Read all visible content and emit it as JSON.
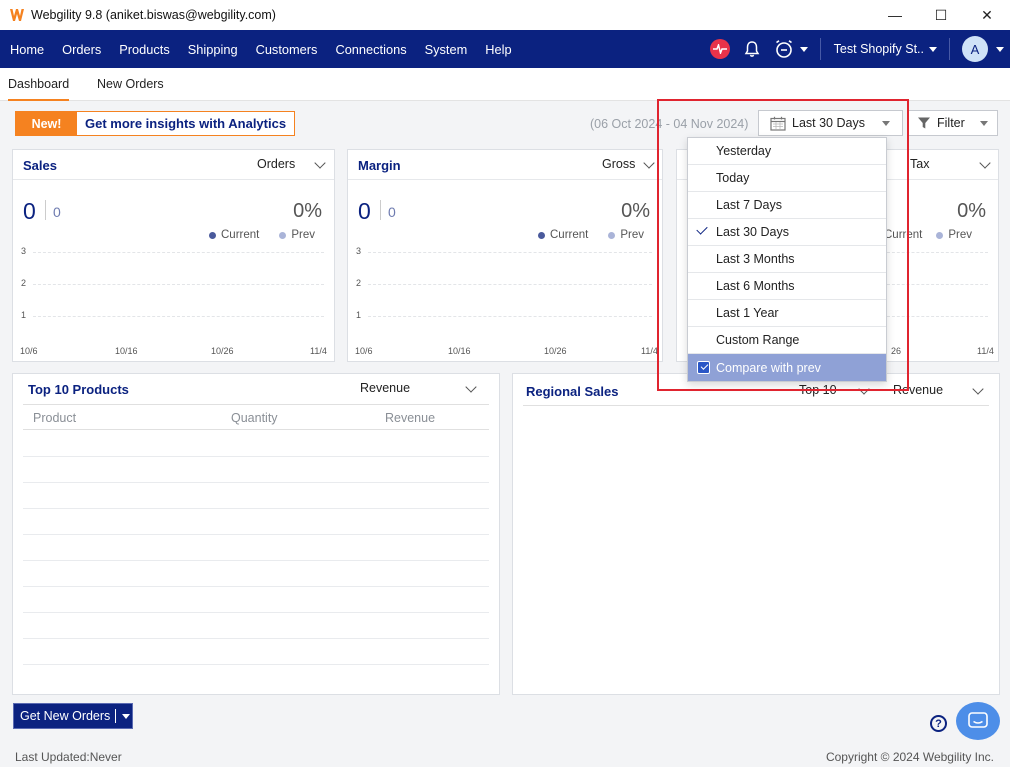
{
  "window": {
    "title": "Webgility 9.8 (aniket.biswas@webgility.com)",
    "minimize_glyph": "—",
    "maximize_glyph": "☐",
    "close_glyph": "✕"
  },
  "menu": {
    "items": [
      "Home",
      "Orders",
      "Products",
      "Shipping",
      "Customers",
      "Connections",
      "System",
      "Help"
    ],
    "store": "Test Shopify St..",
    "avatar": "A"
  },
  "tabs": [
    "Dashboard",
    "New Orders"
  ],
  "banner": {
    "badge": "New!",
    "text": "Get more insights with Analytics"
  },
  "date_range_text": "(06 Oct 2024 - 04 Nov 2024)",
  "date_button": "Last 30 Days",
  "filter_button": "Filter",
  "cards": [
    {
      "title": "Sales",
      "selector": "Orders",
      "value": "0",
      "prev_value": "0",
      "percent": "0%",
      "legend": [
        "Current",
        "Prev"
      ],
      "y_ticks": [
        "3",
        "2",
        "1"
      ],
      "x_ticks": [
        "10/6",
        "10/16",
        "10/26",
        "11/4"
      ]
    },
    {
      "title": "Margin",
      "selector": "Gross",
      "value": "0",
      "prev_value": "0",
      "percent": "0%",
      "legend": [
        "Current",
        "Prev"
      ],
      "y_ticks": [
        "3",
        "2",
        "1"
      ],
      "x_ticks": [
        "10/6",
        "10/16",
        "10/26",
        "11/4"
      ]
    },
    {
      "selector": "Tax",
      "percent": "0%",
      "legend": [
        "Current",
        "Prev"
      ],
      "x_ticks": [
        "26",
        "11/4"
      ]
    }
  ],
  "top_products": {
    "title": "Top 10 Products",
    "selector": "Revenue",
    "columns": [
      "Product",
      "Quantity",
      "Revenue"
    ]
  },
  "regional_sales": {
    "title": "Regional Sales",
    "top_selector": "Top 10",
    "metric_selector": "Revenue"
  },
  "date_dropdown": {
    "options": [
      "Yesterday",
      "Today",
      "Last 7 Days",
      "Last 30 Days",
      "Last 3 Months",
      "Last 6 Months",
      "Last 1 Year",
      "Custom Range"
    ],
    "selected": "Last 30 Days",
    "compare_label": "Compare with prev",
    "compare_checked": true
  },
  "get_orders_button": "Get New Orders",
  "help_glyph": "?",
  "footer": {
    "last_updated": "Last Updated:Never",
    "copyright": "Copyright © 2024 Webgility Inc."
  },
  "colors": {
    "nav": "#0b2280",
    "accent": "#f58220",
    "highlight": "#e0242f",
    "current_dot": "#4a5a9c",
    "prev_dot": "#aab4d8"
  }
}
